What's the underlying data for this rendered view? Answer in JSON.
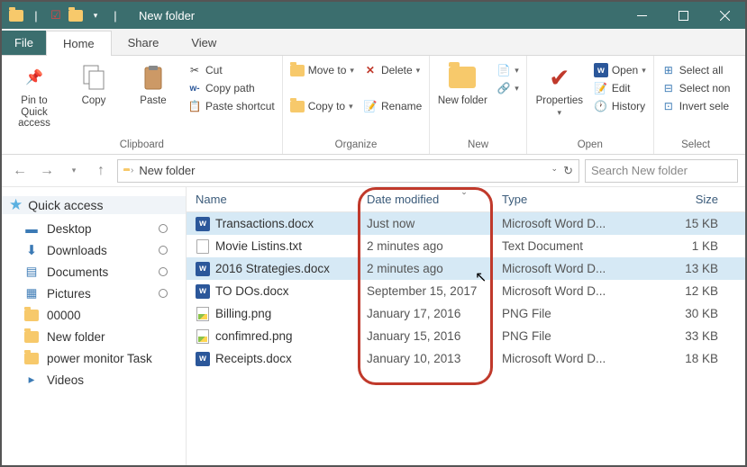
{
  "window": {
    "title": "New folder"
  },
  "menu": {
    "file": "File",
    "tabs": [
      {
        "label": "Home",
        "active": true
      },
      {
        "label": "Share",
        "active": false
      },
      {
        "label": "View",
        "active": false
      }
    ]
  },
  "ribbon": {
    "clipboard": {
      "label": "Clipboard",
      "pin": "Pin to Quick access",
      "copy": "Copy",
      "paste": "Paste",
      "cut": "Cut",
      "copy_path": "Copy path",
      "paste_shortcut": "Paste shortcut"
    },
    "organize": {
      "label": "Organize",
      "move_to": "Move to",
      "copy_to": "Copy to",
      "delete": "Delete",
      "rename": "Rename"
    },
    "new": {
      "label": "New",
      "new_folder": "New folder"
    },
    "open": {
      "label": "Open",
      "properties": "Properties",
      "open": "Open",
      "edit": "Edit",
      "history": "History"
    },
    "select": {
      "label": "Select",
      "select_all": "Select all",
      "select_none": "Select non",
      "invert": "Invert sele"
    }
  },
  "address": {
    "crumb": "New folder",
    "search_placeholder": "Search New folder"
  },
  "sidebar": {
    "quick_access": "Quick access",
    "items": [
      {
        "label": "Desktop",
        "icon": "desktop",
        "pin": true
      },
      {
        "label": "Downloads",
        "icon": "downloads",
        "pin": true
      },
      {
        "label": "Documents",
        "icon": "documents",
        "pin": true
      },
      {
        "label": "Pictures",
        "icon": "pictures",
        "pin": true
      },
      {
        "label": "00000",
        "icon": "folder",
        "pin": false
      },
      {
        "label": "New folder",
        "icon": "folder",
        "pin": false
      },
      {
        "label": "power monitor Task",
        "icon": "folder",
        "pin": false
      },
      {
        "label": "Videos",
        "icon": "videos",
        "pin": false
      }
    ]
  },
  "columns": {
    "name": "Name",
    "date": "Date modified",
    "type": "Type",
    "size": "Size"
  },
  "files": [
    {
      "name": "Transactions.docx",
      "date": "Just now",
      "type": "Microsoft Word D...",
      "size": "15 KB",
      "icon": "word",
      "selected": true
    },
    {
      "name": "Movie Listins.txt",
      "date": "2 minutes ago",
      "type": "Text Document",
      "size": "1 KB",
      "icon": "txt",
      "selected": false
    },
    {
      "name": "2016 Strategies.docx",
      "date": "2 minutes ago",
      "type": "Microsoft Word D...",
      "size": "13 KB",
      "icon": "word",
      "selected": true
    },
    {
      "name": "TO DOs.docx",
      "date": "September 15, 2017",
      "type": "Microsoft Word D...",
      "size": "12 KB",
      "icon": "word",
      "selected": false
    },
    {
      "name": "Billing.png",
      "date": "January 17, 2016",
      "type": "PNG File",
      "size": "30 KB",
      "icon": "png",
      "selected": false
    },
    {
      "name": "confimred.png",
      "date": "January 15, 2016",
      "type": "PNG File",
      "size": "33 KB",
      "icon": "png",
      "selected": false
    },
    {
      "name": "Receipts.docx",
      "date": "January 10, 2013",
      "type": "Microsoft Word D...",
      "size": "18 KB",
      "icon": "word",
      "selected": false
    }
  ]
}
